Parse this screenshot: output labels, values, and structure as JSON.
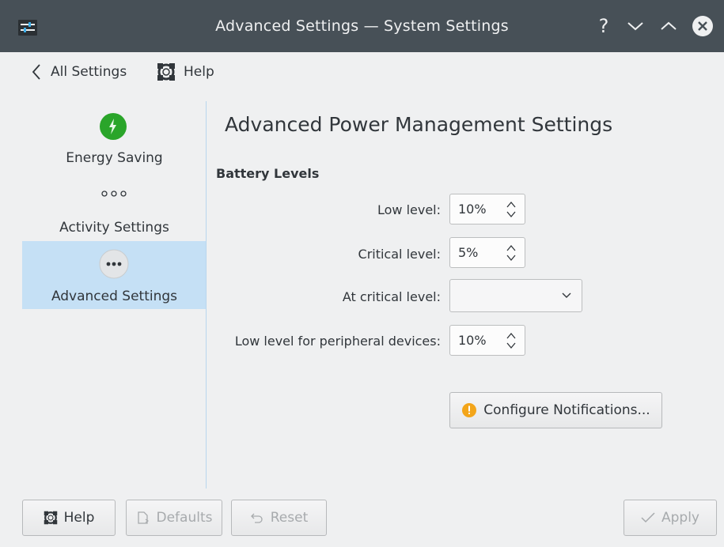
{
  "window": {
    "title": "Advanced Settings  — System Settings",
    "help_glyph": "?",
    "icons": [
      "app-icon",
      "help-icon",
      "minimize-icon",
      "maximize-icon",
      "close-icon"
    ]
  },
  "toolbar": {
    "back_label": "All Settings",
    "help_label": "Help"
  },
  "sidebar": {
    "items": [
      {
        "label": "Energy Saving",
        "icon": "lightning-icon",
        "selected": false
      },
      {
        "label": "Activity Settings",
        "icon": "dots-icon",
        "selected": false
      },
      {
        "label": "Advanced Settings",
        "icon": "more-icon",
        "selected": true
      }
    ],
    "selected_color": "#c5e0f5"
  },
  "main": {
    "title": "Advanced Power Management Settings",
    "section": "Battery Levels",
    "fields": [
      {
        "label": "Low level:",
        "value": "10%"
      },
      {
        "label": "Critical level:",
        "value": "5%"
      },
      {
        "label": "At critical level:",
        "value": ""
      },
      {
        "label": "Low level for peripheral devices:",
        "value": "10%"
      }
    ],
    "configure_notifications": "Configure Notifications..."
  },
  "footer": {
    "help": "Help",
    "defaults": "Defaults",
    "reset": "Reset",
    "apply": "Apply"
  },
  "colors": {
    "titlebar": "#475057",
    "energy_green": "#2aa52a",
    "warning_orange": "#f3a51a"
  }
}
